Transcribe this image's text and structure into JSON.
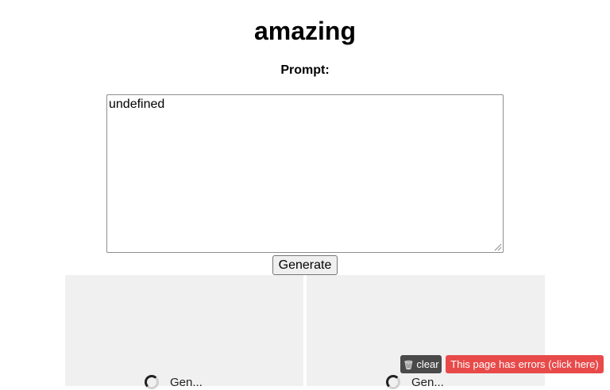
{
  "page": {
    "title": "amazing",
    "prompt_label": "Prompt:"
  },
  "prompt": {
    "value": "undefined"
  },
  "actions": {
    "generate_label": "Generate"
  },
  "image_panels": [
    {
      "status": "Gen..."
    },
    {
      "status": "Gen..."
    }
  ],
  "devtools": {
    "clear_icon": "trash-icon",
    "clear_label": "clear",
    "errors_label": "This page has errors (click here)"
  },
  "colors": {
    "errors_banner": "#e84a4a",
    "clear_button": "#4a4a4a",
    "panel_background": "#f0f0f0"
  }
}
